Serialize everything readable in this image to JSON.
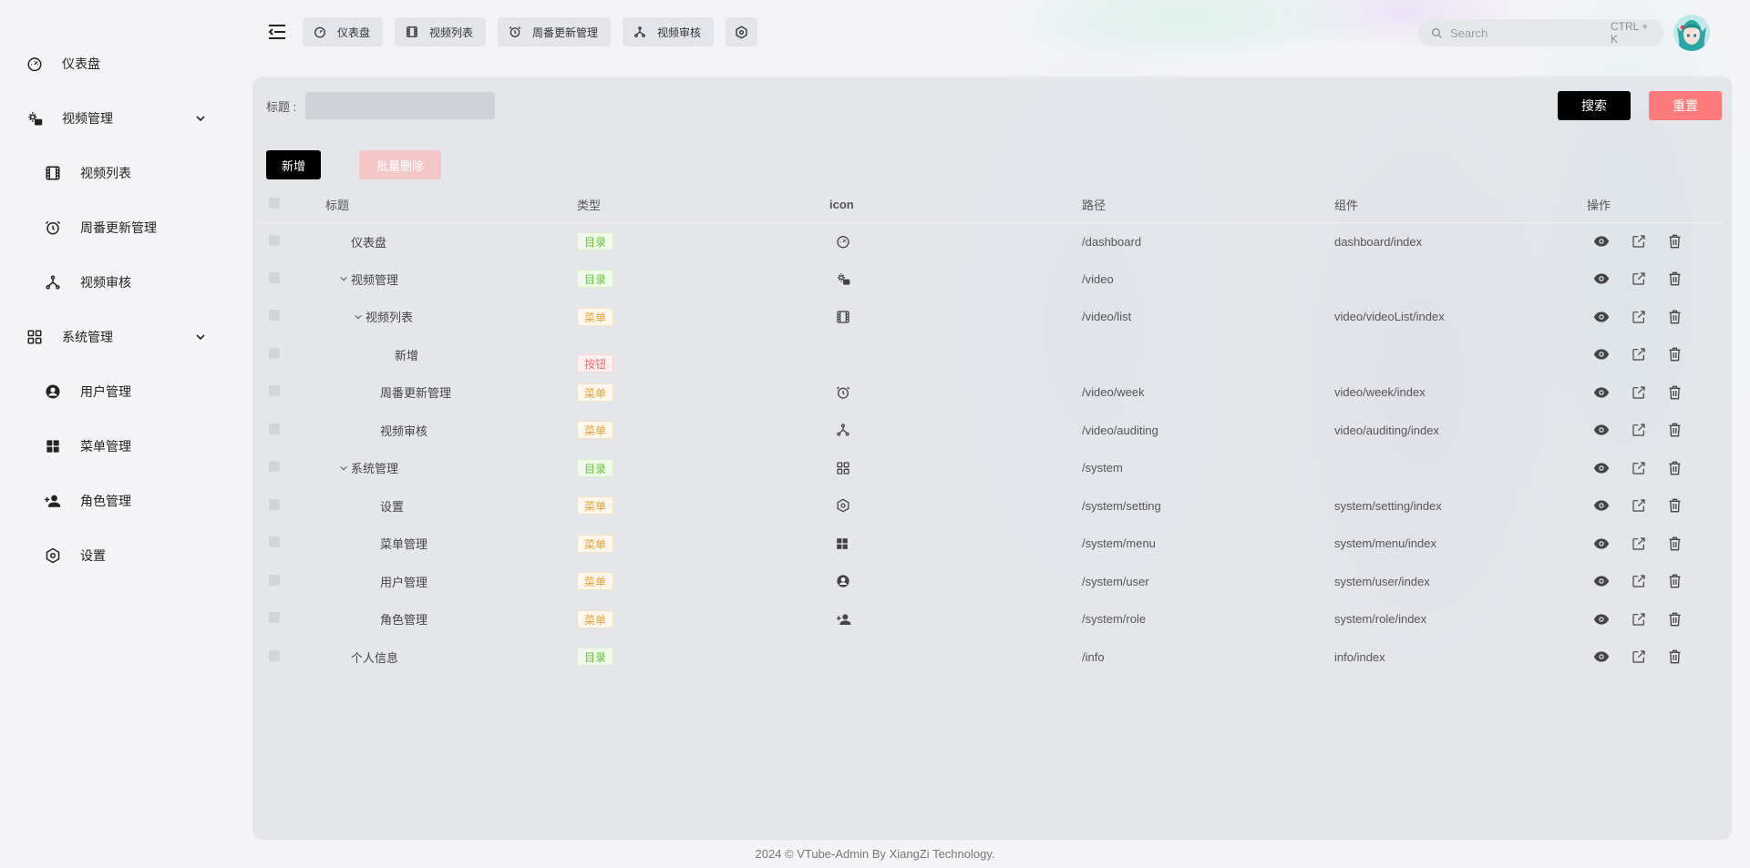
{
  "sidebar": {
    "items": [
      {
        "label": "仪表盘",
        "icon": "dashboard-icon"
      },
      {
        "label": "视频管理",
        "icon": "gear-video-icon"
      },
      {
        "label": "视频列表",
        "icon": "film-icon"
      },
      {
        "label": "周番更新管理",
        "icon": "alarm-icon"
      },
      {
        "label": "视频审核",
        "icon": "fork-icon"
      },
      {
        "label": "系统管理",
        "icon": "grid-icon"
      },
      {
        "label": "用户管理",
        "icon": "user-circle-icon"
      },
      {
        "label": "菜单管理",
        "icon": "menu-grid-icon"
      },
      {
        "label": "角色管理",
        "icon": "user-add-icon"
      },
      {
        "label": "设置",
        "icon": "settings-hex-icon"
      }
    ]
  },
  "tabs": [
    {
      "label": "仪表盘"
    },
    {
      "label": "视频列表"
    },
    {
      "label": "周番更新管理"
    },
    {
      "label": "视频审核"
    }
  ],
  "search": {
    "placeholder": "Search",
    "shortcut": "CTRL + K"
  },
  "filter": {
    "title_label": "标题 :",
    "search_button": "搜索",
    "reset_button": "重置"
  },
  "actions": {
    "add_button": "新增",
    "bulk_delete_button": "批量删除"
  },
  "table": {
    "headers": {
      "title": "标题",
      "type": "类型",
      "icon": "icon",
      "path": "路径",
      "component": "组件",
      "ops": "操作"
    },
    "rows": [
      {
        "title": "仪表盘",
        "type": "目录",
        "path": "/dashboard",
        "component": "dashboard/index"
      },
      {
        "title": "视频管理",
        "type": "目录",
        "path": "/video",
        "component": ""
      },
      {
        "title": "视频列表",
        "type": "菜单",
        "path": "/video/list",
        "component": "video/videoList/index"
      },
      {
        "title": "新增",
        "type": "按钮",
        "path": "",
        "component": ""
      },
      {
        "title": "周番更新管理",
        "type": "菜单",
        "path": "/video/week",
        "component": "video/week/index"
      },
      {
        "title": "视频审核",
        "type": "菜单",
        "path": "/video/auditing",
        "component": "video/auditing/index"
      },
      {
        "title": "系统管理",
        "type": "目录",
        "path": "/system",
        "component": ""
      },
      {
        "title": "设置",
        "type": "菜单",
        "path": "/system/setting",
        "component": "system/setting/index"
      },
      {
        "title": "菜单管理",
        "type": "菜单",
        "path": "/system/menu",
        "component": "system/menu/index"
      },
      {
        "title": "用户管理",
        "type": "菜单",
        "path": "/system/user",
        "component": "system/user/index"
      },
      {
        "title": "角色管理",
        "type": "菜单",
        "path": "/system/role",
        "component": "system/role/index"
      },
      {
        "title": "个人信息",
        "type": "目录",
        "path": "/info",
        "component": "info/index"
      }
    ]
  },
  "footer": {
    "text": "2024 © VTube-Admin By XiangZi Technology."
  },
  "colors": {
    "primary": "#000000",
    "danger": "#ff7a7a",
    "dir_tag": "#67c23a",
    "menu_tag": "#e6a23c",
    "button_tag": "#f56c6c"
  }
}
